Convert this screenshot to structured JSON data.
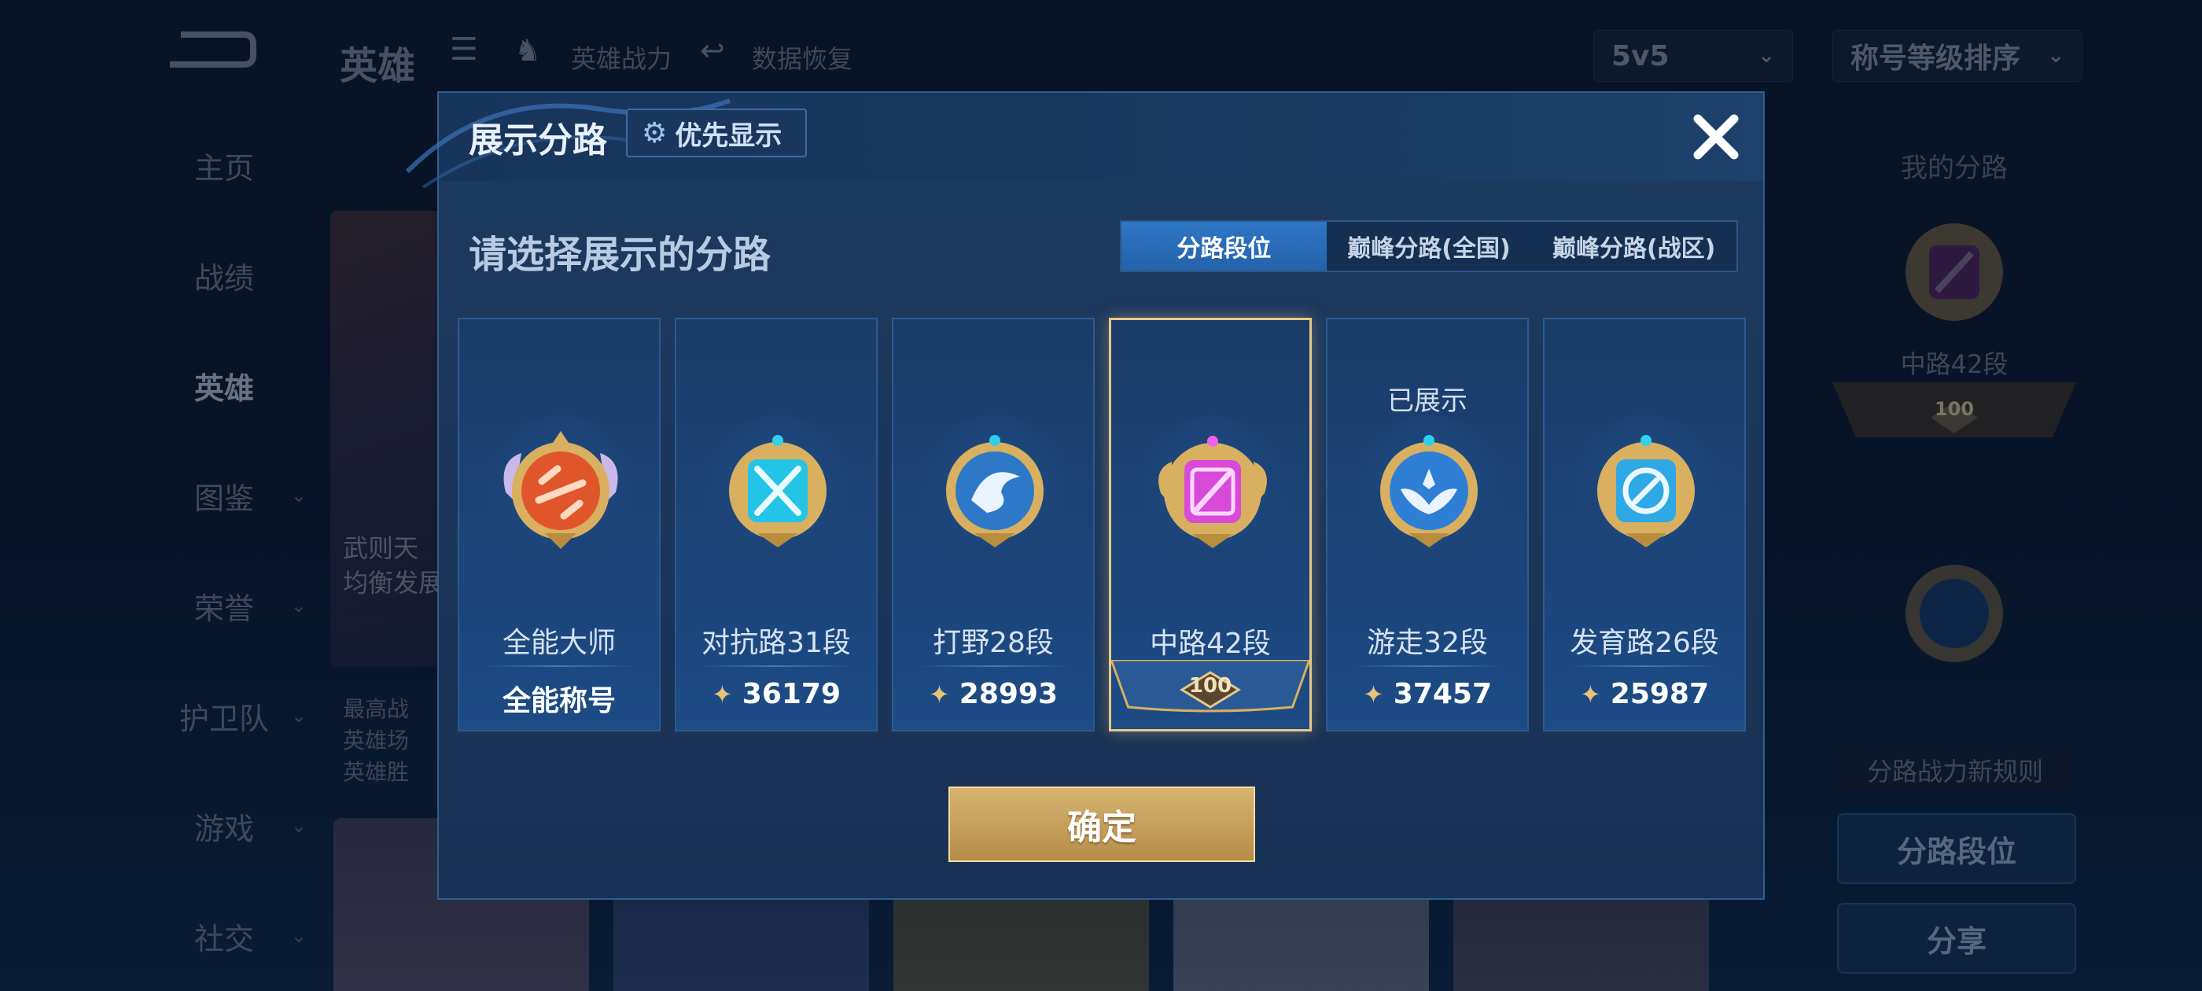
{
  "header": {
    "title": "英雄",
    "links": [
      "英雄战力",
      "数据恢复"
    ],
    "mode_select": "5v5",
    "sort_select": "称号等级排序"
  },
  "nav": [
    "主页",
    "战绩",
    "英雄",
    "图鉴",
    "荣誉",
    "护卫队",
    "游戏",
    "社交"
  ],
  "hero_card": {
    "lines": [
      "武则天",
      "均衡发展"
    ],
    "info": [
      "最高战",
      "英雄场",
      "英雄胜"
    ]
  },
  "right_panel": {
    "title": "我的分路",
    "my_lane": "中路42段",
    "my_rank": "100",
    "rule_label": "分路战力新规则",
    "lane_rank_button": "分路段位",
    "share_button": "分享"
  },
  "modal": {
    "title": "展示分路",
    "priority_button": "优先显示",
    "subtitle": "请选择展示的分路",
    "tabs": [
      "分路段位",
      "巅峰分路(全国)",
      "巅峰分路(战区)"
    ],
    "active_tab": 0,
    "confirm_button": "确定",
    "cards": [
      {
        "label": "全能大师",
        "value": "全能称号",
        "color": "#e0552a",
        "has_star": false
      },
      {
        "label": "对抗路31段",
        "value": "36179",
        "color": "#23c4e6",
        "has_star": true
      },
      {
        "label": "打野28段",
        "value": "28993",
        "color": "#2e78c8",
        "has_star": true
      },
      {
        "label": "中路42段",
        "value": "100",
        "color": "#d84ad8",
        "has_star": false,
        "selected": true
      },
      {
        "label": "游走32段",
        "value": "37457",
        "color": "#2f7fd6",
        "has_star": true,
        "shown_tag": "已展示"
      },
      {
        "label": "发育路26段",
        "value": "25987",
        "color": "#2fa8e6",
        "has_star": true
      }
    ]
  }
}
